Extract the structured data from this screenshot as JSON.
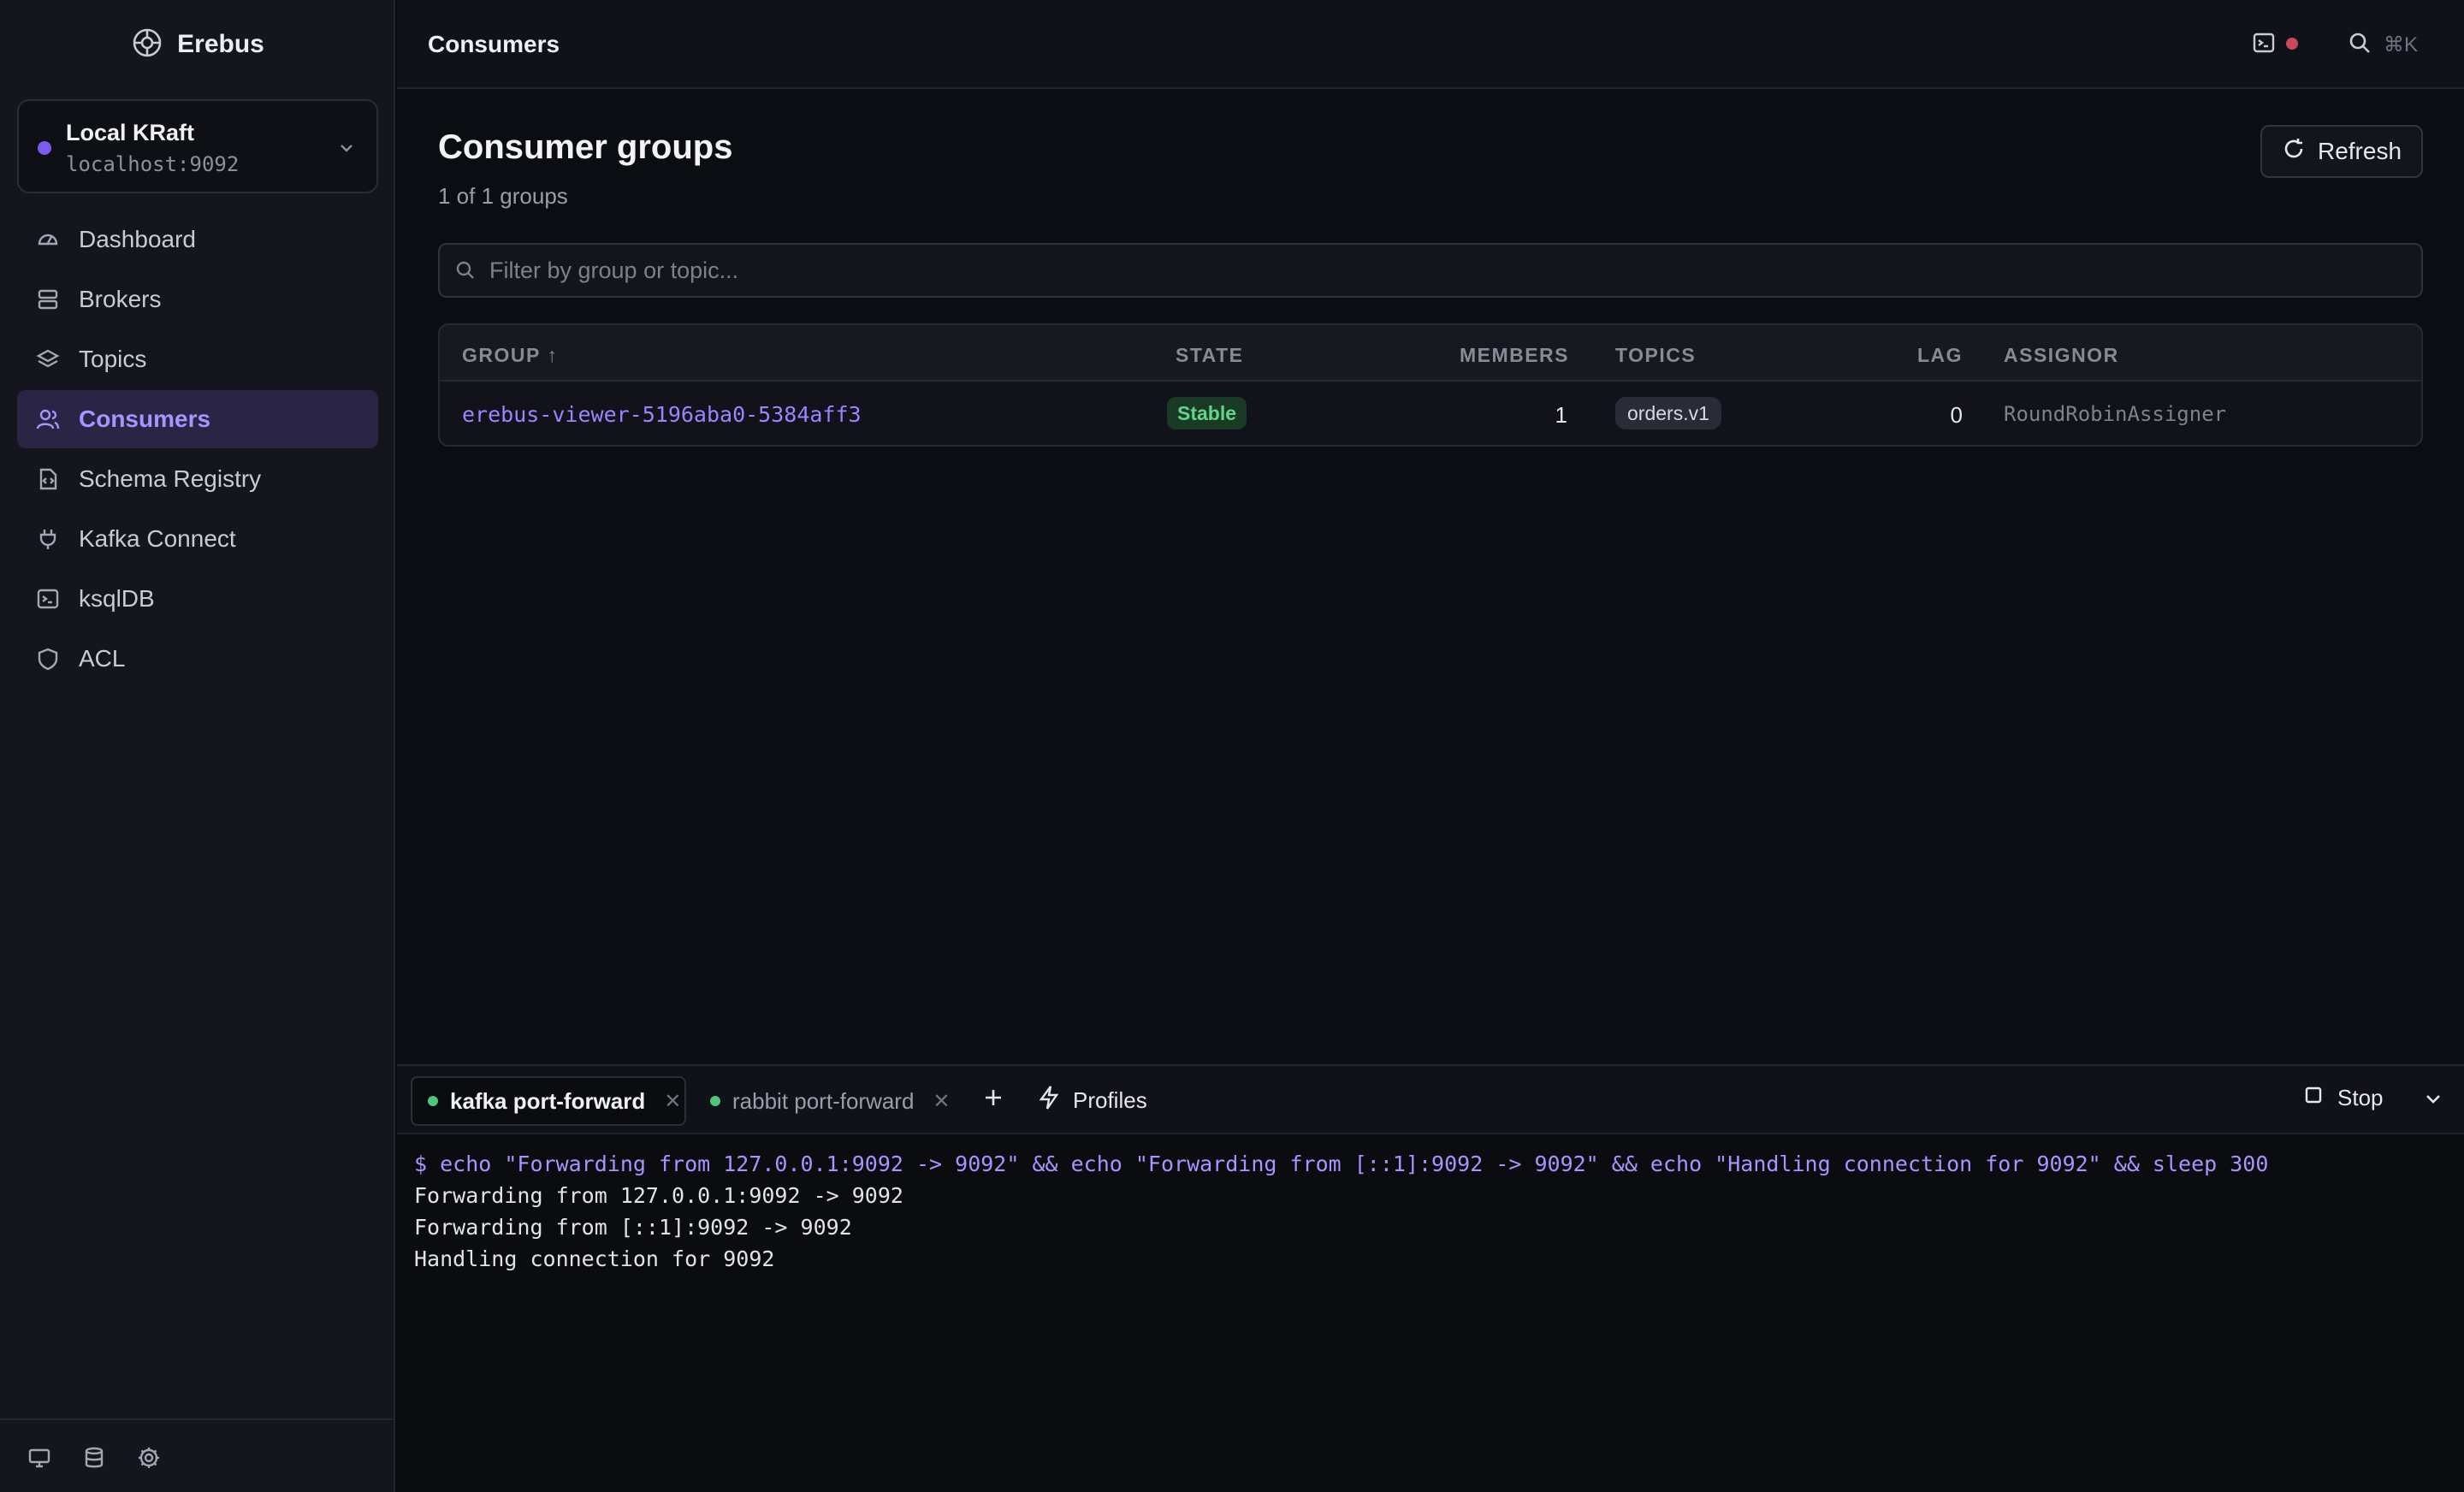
{
  "app": {
    "name": "Erebus"
  },
  "cluster": {
    "name": "Local KRaft",
    "host": "localhost:9092"
  },
  "nav": [
    {
      "label": "Dashboard",
      "icon": "gauge-icon"
    },
    {
      "label": "Brokers",
      "icon": "server-icon"
    },
    {
      "label": "Topics",
      "icon": "layers-icon"
    },
    {
      "label": "Consumers",
      "icon": "users-icon",
      "active": true
    },
    {
      "label": "Schema Registry",
      "icon": "file-code-icon"
    },
    {
      "label": "Kafka Connect",
      "icon": "plug-icon"
    },
    {
      "label": "ksqlDB",
      "icon": "terminal-icon"
    },
    {
      "label": "ACL",
      "icon": "shield-icon"
    }
  ],
  "topbar": {
    "title": "Consumers",
    "shortcut": "⌘K"
  },
  "page": {
    "title": "Consumer groups",
    "subtitle": "1 of 1 groups",
    "refresh_label": "Refresh",
    "filter_placeholder": "Filter by group or topic..."
  },
  "table": {
    "headers": {
      "group": "GROUP ↑",
      "state": "STATE",
      "members": "MEMBERS",
      "topics": "TOPICS",
      "lag": "LAG",
      "assignor": "ASSIGNOR"
    },
    "rows": [
      {
        "group": "erebus-viewer-5196aba0-5384aff3",
        "state": "Stable",
        "members": "1",
        "topics": "orders.v1",
        "lag": "0",
        "assignor": "RoundRobinAssigner"
      }
    ]
  },
  "terminal": {
    "tabs": [
      {
        "label": "kafka port-forward",
        "active": true
      },
      {
        "label": "rabbit port-forward",
        "active": false
      }
    ],
    "profiles_label": "Profiles",
    "stop_label": "Stop",
    "lines": [
      "$ echo \"Forwarding from 127.0.0.1:9092 -> 9092\" && echo \"Forwarding from [::1]:9092 -> 9092\" && echo \"Handling connection for 9092\" && sleep 300",
      "Forwarding from 127.0.0.1:9092 -> 9092",
      "Forwarding from [::1]:9092 -> 9092",
      "Handling connection for 9092"
    ]
  },
  "colors": {
    "accent": "#a893ff",
    "status_ok": "#5fd68a",
    "recording": "#c9485a"
  }
}
